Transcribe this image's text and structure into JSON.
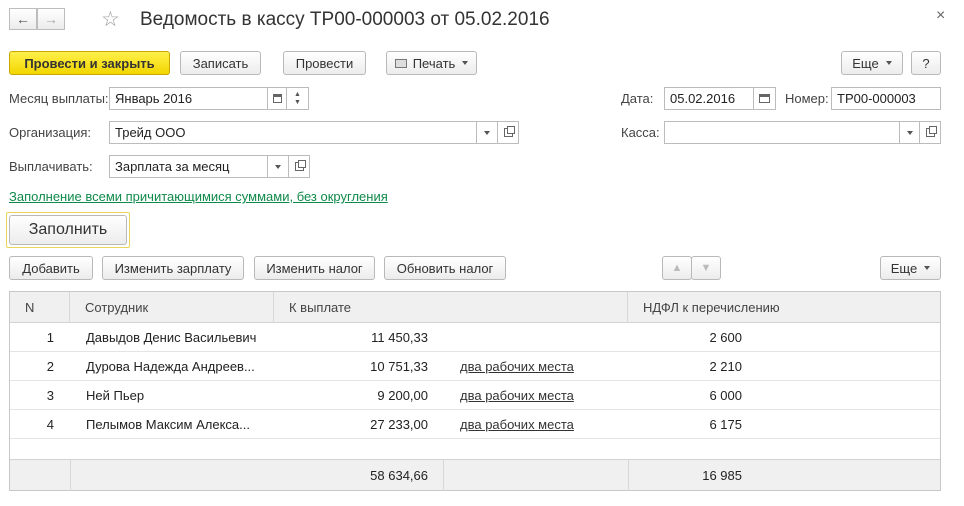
{
  "window": {
    "title": "Ведомость в кассу ТР00-000003 от 05.02.2016",
    "close_glyph": "×"
  },
  "toolbar": {
    "post_close": "Провести и закрыть",
    "save": "Записать",
    "post": "Провести",
    "print": "Печать",
    "more": "Еще",
    "help": "?"
  },
  "form": {
    "month_label": "Месяц выплаты:",
    "month_value": "Январь 2016",
    "date_label": "Дата:",
    "date_value": "05.02.2016",
    "number_label": "Номер:",
    "number_value": "ТР00-000003",
    "org_label": "Организация:",
    "org_value": "Трейд ООО",
    "cash_label": "Касса:",
    "cash_value": "",
    "pay_label": "Выплачивать:",
    "pay_value": "Зарплата за месяц",
    "fill_hint": "Заполнение всеми причитающимися суммами, без округления",
    "fill_button": "Заполнить"
  },
  "table_toolbar": {
    "add": "Добавить",
    "change_salary": "Изменить зарплату",
    "change_tax": "Изменить налог",
    "update_tax": "Обновить налог",
    "more": "Еще"
  },
  "table": {
    "columns": [
      "N",
      "Сотрудник",
      "К выплате",
      "НДФЛ к перечислению"
    ],
    "rows": [
      {
        "n": "1",
        "employee": "Давыдов Денис Васильевич",
        "amount": "11 450,33",
        "note": "",
        "tax": "2 600"
      },
      {
        "n": "2",
        "employee": "Дурова Надежда Андреев...",
        "amount": "10 751,33",
        "note": "два рабочих места",
        "tax": "2 210"
      },
      {
        "n": "3",
        "employee": "Ней Пьер",
        "amount": "9 200,00",
        "note": "два рабочих места",
        "tax": "6 000"
      },
      {
        "n": "4",
        "employee": "Пелымов Максим Алекса...",
        "amount": "27 233,00",
        "note": "два рабочих места",
        "tax": "6 175"
      }
    ],
    "total_amount": "58 634,66",
    "total_tax": "16 985"
  },
  "colors": {
    "primary_button": "#f5dc00",
    "hint_link": "#0f8a4a"
  }
}
